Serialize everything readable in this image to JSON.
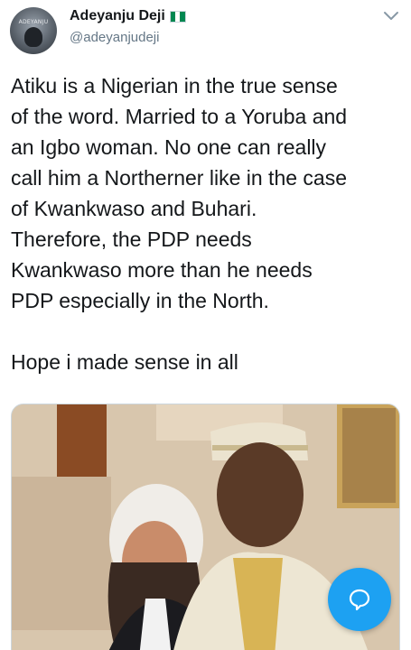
{
  "tweet": {
    "author": {
      "name": "Adeyanju Deji",
      "handle": "@adeyanjudeji",
      "avatar_text": "ADEYANJU",
      "flag_colors": [
        "#008751",
        "#ffffff",
        "#008751"
      ]
    },
    "text": "Atiku is a Nigerian in the true sense\nof the word. Married to a Yoruba and\nan Igbo woman. No one can really\ncall him a Northerner like in the case\nof Kwankwaso and Buhari.\nTherefore, the PDP needs\nKwankwaso more than he needs\nPDP especially in the North.\n\nHope i made sense in all",
    "menu_icon": "chevron-down-icon"
  },
  "compose_button": {
    "icon": "speech-bubble-icon",
    "color": "#1da1f2"
  },
  "colors": {
    "accent": "#1da1f2",
    "text_primary": "#14171a",
    "text_secondary": "#657786"
  }
}
